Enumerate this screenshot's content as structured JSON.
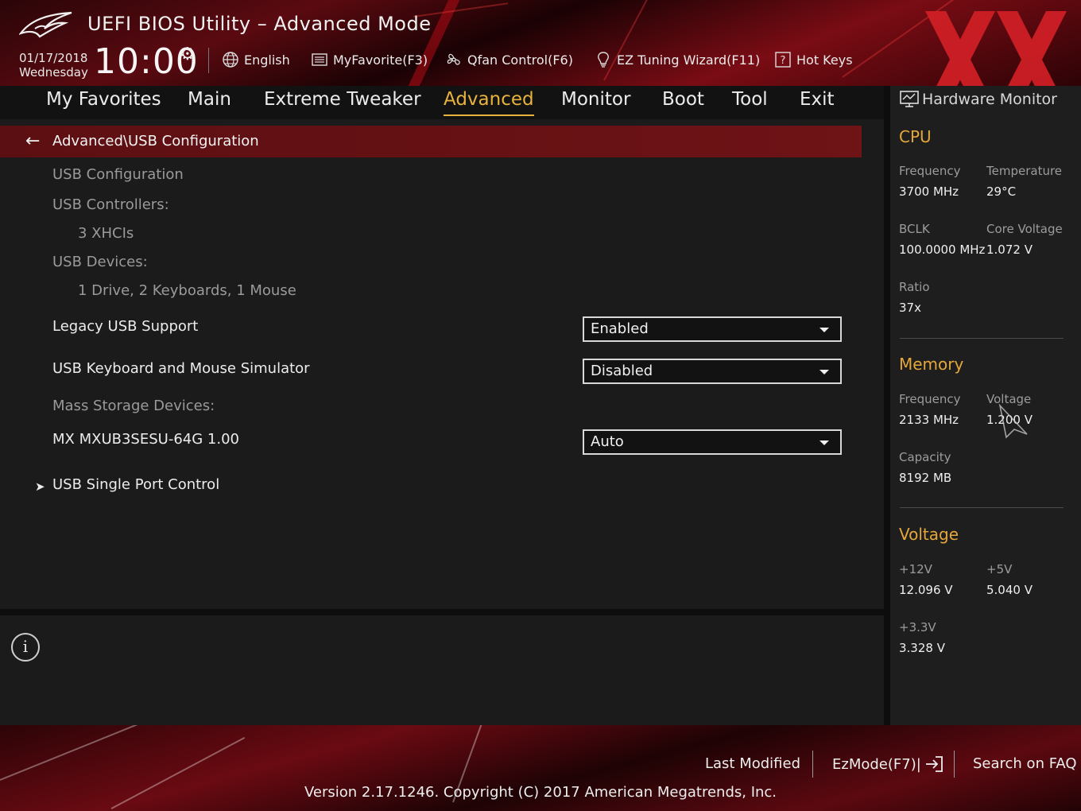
{
  "header": {
    "title": "UEFI BIOS Utility – Advanced Mode",
    "date": "01/17/2018",
    "weekday": "Wednesday",
    "time": "10:00",
    "tools": [
      {
        "label": "English",
        "icon": "globe-icon"
      },
      {
        "label": "MyFavorite(F3)",
        "icon": "favorite-list-icon"
      },
      {
        "label": "Qfan Control(F6)",
        "icon": "fan-icon"
      },
      {
        "label": "EZ Tuning Wizard(F11)",
        "icon": "lightbulb-icon"
      },
      {
        "label": "Hot Keys",
        "icon": "help-box-icon"
      }
    ]
  },
  "nav": {
    "tabs": [
      "My Favorites",
      "Main",
      "Extreme Tweaker",
      "Advanced",
      "Monitor",
      "Boot",
      "Tool",
      "Exit"
    ],
    "active": "Advanced"
  },
  "main": {
    "breadcrumb": "Advanced\\USB Configuration",
    "usb_configuration": "USB Configuration",
    "usb_controllers_label": "USB Controllers:",
    "usb_controllers_value": "3 XHCIs",
    "usb_devices_label": "USB Devices:",
    "usb_devices_value": "1 Drive, 2 Keyboards, 1 Mouse",
    "legacy_usb_label": "Legacy USB Support",
    "legacy_usb_value": "Enabled",
    "kbm_simulator_label": "USB Keyboard and Mouse Simulator",
    "kbm_simulator_value": "Disabled",
    "mass_storage_label": "Mass Storage Devices:",
    "drive_label": "MX MXUB3SESU-64G 1.00",
    "drive_value": "Auto",
    "single_port_label": "USB Single Port Control"
  },
  "hardware_monitor": {
    "title": "Hardware Monitor",
    "cpu": {
      "title": "CPU",
      "frequency_label": "Frequency",
      "frequency_value": "3700 MHz",
      "temperature_label": "Temperature",
      "temperature_value": "29°C",
      "bclk_label": "BCLK",
      "bclk_value": "100.0000 MHz",
      "core_voltage_label": "Core Voltage",
      "core_voltage_value": "1.072 V",
      "ratio_label": "Ratio",
      "ratio_value": "37x"
    },
    "memory": {
      "title": "Memory",
      "frequency_label": "Frequency",
      "frequency_value": "2133 MHz",
      "voltage_label": "Voltage",
      "voltage_value": "1.200 V",
      "capacity_label": "Capacity",
      "capacity_value": "8192 MB"
    },
    "voltage": {
      "title": "Voltage",
      "v12_label": "+12V",
      "v12_value": "12.096 V",
      "v5_label": "+5V",
      "v5_value": "5.040 V",
      "v33_label": "+3.3V",
      "v33_value": "3.328 V"
    }
  },
  "footer": {
    "last_modified": "Last Modified",
    "ezmode": "EzMode(F7)|",
    "search_faq": "Search on FAQ",
    "version": "Version 2.17.1246. Copyright (C) 2017 American Megatrends, Inc."
  },
  "colors": {
    "accent": "#e8b23c",
    "breadcrumb_bg": "#6e1316",
    "panel_bg": "#1b1b1b",
    "header_red": "#7a0c14"
  }
}
